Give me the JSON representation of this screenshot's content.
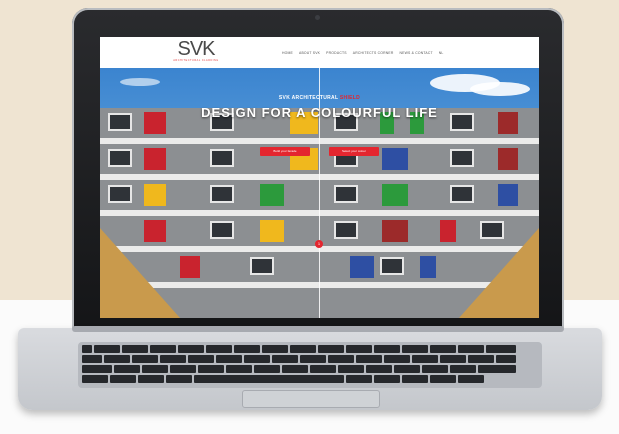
{
  "site": {
    "logo_mark": "SVK",
    "logo_tagline": "ARCHITECTURAL CLADDING",
    "nav": [
      {
        "label": "HOME"
      },
      {
        "label": "ABOUT SVK"
      },
      {
        "label": "PRODUCTS"
      },
      {
        "label": "ARCHITECTS CORNER"
      },
      {
        "label": "NEWS & CONTACT"
      },
      {
        "label": "NL"
      }
    ]
  },
  "hero": {
    "kicker_a": "SVK",
    "kicker_b": "ARCHITECTURAL",
    "kicker_c": "SHIELD",
    "title": "DESIGN FOR A COLOURFUL LIFE",
    "cta_left": "Build your facade",
    "cta_right": "Select your colour",
    "slider_indicator": "1"
  },
  "colors": {
    "accent": "#e4262f",
    "background_top": "#efe4d2",
    "laptop_bezel": "#1b1c1f"
  }
}
